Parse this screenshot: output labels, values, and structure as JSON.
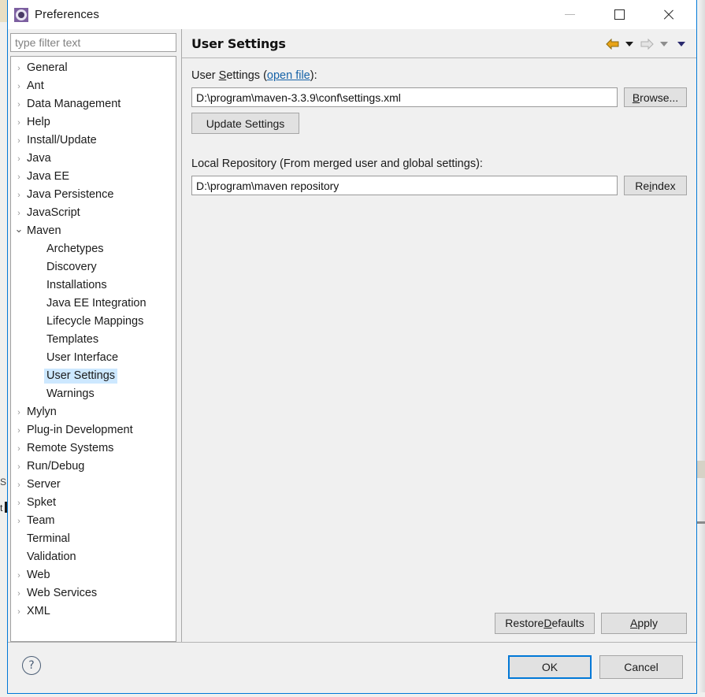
{
  "window": {
    "title": "Preferences",
    "icon": "preferences-gear-icon",
    "accent_color": "#0078d7",
    "controls": {
      "minimize": "minimize-icon",
      "maximize": "maximize-icon",
      "close": "close-icon"
    }
  },
  "sidebar": {
    "filter": {
      "placeholder": "type filter text",
      "value": ""
    },
    "items": [
      {
        "label": "General",
        "level": 0,
        "expandable": true,
        "expanded": false,
        "selected": false
      },
      {
        "label": "Ant",
        "level": 0,
        "expandable": true,
        "expanded": false,
        "selected": false
      },
      {
        "label": "Data Management",
        "level": 0,
        "expandable": true,
        "expanded": false,
        "selected": false
      },
      {
        "label": "Help",
        "level": 0,
        "expandable": true,
        "expanded": false,
        "selected": false
      },
      {
        "label": "Install/Update",
        "level": 0,
        "expandable": true,
        "expanded": false,
        "selected": false
      },
      {
        "label": "Java",
        "level": 0,
        "expandable": true,
        "expanded": false,
        "selected": false
      },
      {
        "label": "Java EE",
        "level": 0,
        "expandable": true,
        "expanded": false,
        "selected": false
      },
      {
        "label": "Java Persistence",
        "level": 0,
        "expandable": true,
        "expanded": false,
        "selected": false
      },
      {
        "label": "JavaScript",
        "level": 0,
        "expandable": true,
        "expanded": false,
        "selected": false
      },
      {
        "label": "Maven",
        "level": 0,
        "expandable": true,
        "expanded": true,
        "selected": false
      },
      {
        "label": "Archetypes",
        "level": 1,
        "expandable": false,
        "expanded": false,
        "selected": false
      },
      {
        "label": "Discovery",
        "level": 1,
        "expandable": false,
        "expanded": false,
        "selected": false
      },
      {
        "label": "Installations",
        "level": 1,
        "expandable": false,
        "expanded": false,
        "selected": false
      },
      {
        "label": "Java EE Integration",
        "level": 1,
        "expandable": false,
        "expanded": false,
        "selected": false
      },
      {
        "label": "Lifecycle Mappings",
        "level": 1,
        "expandable": false,
        "expanded": false,
        "selected": false
      },
      {
        "label": "Templates",
        "level": 1,
        "expandable": false,
        "expanded": false,
        "selected": false
      },
      {
        "label": "User Interface",
        "level": 1,
        "expandable": false,
        "expanded": false,
        "selected": false
      },
      {
        "label": "User Settings",
        "level": 1,
        "expandable": false,
        "expanded": false,
        "selected": true
      },
      {
        "label": "Warnings",
        "level": 1,
        "expandable": false,
        "expanded": false,
        "selected": false
      },
      {
        "label": "Mylyn",
        "level": 0,
        "expandable": true,
        "expanded": false,
        "selected": false
      },
      {
        "label": "Plug-in Development",
        "level": 0,
        "expandable": true,
        "expanded": false,
        "selected": false
      },
      {
        "label": "Remote Systems",
        "level": 0,
        "expandable": true,
        "expanded": false,
        "selected": false
      },
      {
        "label": "Run/Debug",
        "level": 0,
        "expandable": true,
        "expanded": false,
        "selected": false
      },
      {
        "label": "Server",
        "level": 0,
        "expandable": true,
        "expanded": false,
        "selected": false
      },
      {
        "label": "Spket",
        "level": 0,
        "expandable": true,
        "expanded": false,
        "selected": false
      },
      {
        "label": "Team",
        "level": 0,
        "expandable": true,
        "expanded": false,
        "selected": false
      },
      {
        "label": "Terminal",
        "level": 0,
        "expandable": false,
        "expanded": false,
        "selected": false
      },
      {
        "label": "Validation",
        "level": 0,
        "expandable": false,
        "expanded": false,
        "selected": false
      },
      {
        "label": "Web",
        "level": 0,
        "expandable": true,
        "expanded": false,
        "selected": false
      },
      {
        "label": "Web Services",
        "level": 0,
        "expandable": true,
        "expanded": false,
        "selected": false
      },
      {
        "label": "XML",
        "level": 0,
        "expandable": true,
        "expanded": false,
        "selected": false
      }
    ]
  },
  "content": {
    "title": "User Settings",
    "toolbar": {
      "back": "back-arrow-icon",
      "back_menu": "back-dropdown-icon",
      "forward": "forward-arrow-icon",
      "forward_menu": "forward-dropdown-icon",
      "view_menu": "view-menu-dropdown-icon",
      "back_color": "#e8a317",
      "forward_color": "#d8d8d8"
    },
    "user_settings": {
      "label_prefix": "User ",
      "label_underlined": "S",
      "label_suffix": "ettings (",
      "link_text": "open file",
      "label_end": "):",
      "value": "D:\\program\\maven-3.3.9\\conf\\settings.xml",
      "browse_button": {
        "pre": "",
        "u": "B",
        "post": "rowse..."
      },
      "update_button": "Update Settings"
    },
    "local_repository": {
      "label": "Local Repository (From merged user and global settings):",
      "value": "D:\\program\\maven repository",
      "reindex_button": {
        "pre": "Re",
        "u": "i",
        "post": "ndex"
      }
    },
    "restore_defaults_button": {
      "pre": "Restore ",
      "u": "D",
      "post": "efaults"
    },
    "apply_button": {
      "pre": "",
      "u": "A",
      "post": "pply"
    }
  },
  "footer": {
    "help_icon": "help-question-icon",
    "help_glyph": "?",
    "ok_button": "OK",
    "cancel_button": "Cancel"
  },
  "background_artifacts": {
    "left_text_1": "S",
    "left_text_2": "t"
  }
}
